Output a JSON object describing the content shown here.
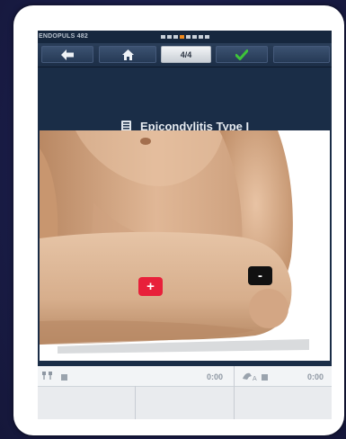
{
  "status": {
    "brand": "ENDOPULS 482"
  },
  "nav": {
    "back_icon": "arrow-left-icon",
    "home_icon": "home-icon",
    "page_label": "4/4",
    "confirm_icon": "checkmark-icon"
  },
  "header": {
    "icon": "document-list-icon",
    "title": "Epicondylitis Type I"
  },
  "electrodes": {
    "positive_label": "+",
    "negative_label": "-",
    "positive_color": "#e8203a",
    "negative_color": "#111111"
  },
  "bottom": {
    "timer_left": "0:00",
    "timer_right": "0:00"
  },
  "colors": {
    "accent": "#f08a1d",
    "check": "#3ec43a",
    "screen_bg": "#1a2d47"
  }
}
